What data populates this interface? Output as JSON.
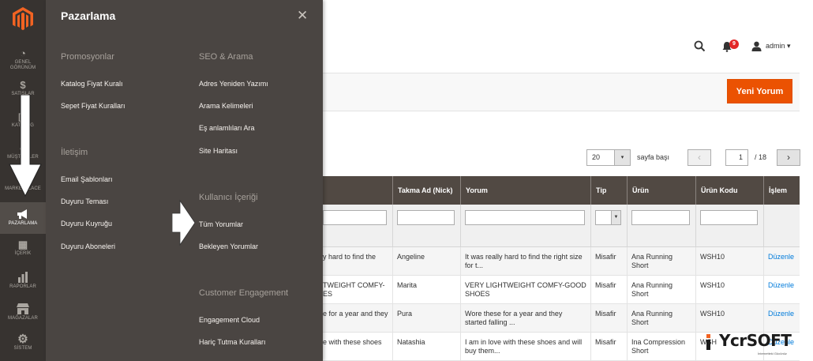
{
  "sidebar": {
    "items": [
      {
        "icon": "dashboard-icon",
        "glyph": "◔",
        "label_lines": [
          "GENEL",
          "GÖRÜNÜM"
        ]
      },
      {
        "icon": "dollar-icon",
        "glyph": "$",
        "label_lines": [
          "SATIŞLAR"
        ]
      },
      {
        "icon": "box-icon",
        "glyph": "▣",
        "label_lines": [
          "KATALOG"
        ]
      },
      {
        "icon": "customers-icon",
        "glyph": "☻",
        "label_lines": [
          "MÜŞTERİLER"
        ]
      },
      {
        "icon": "marketplace-icon",
        "glyph": "⬡",
        "label_lines": [
          "MARKETPLACE"
        ]
      },
      {
        "icon": "megaphone-icon",
        "glyph": "📢",
        "label_lines": [
          "PAZARLAMA"
        ]
      },
      {
        "icon": "content-icon",
        "glyph": "▦",
        "label_lines": [
          "İÇERİK"
        ]
      },
      {
        "icon": "reports-icon",
        "glyph": "▮",
        "label_lines": [
          "RAPORLAR"
        ]
      },
      {
        "icon": "stores-icon",
        "glyph": "⌂",
        "label_lines": [
          "MAĞAZALAR"
        ]
      },
      {
        "icon": "gear-icon",
        "glyph": "⚙",
        "label_lines": [
          "SİSTEM"
        ]
      }
    ]
  },
  "flyout": {
    "title": "Pazarlama",
    "close_glyph": "✕",
    "left_sections": [
      {
        "heading": "Promosyonlar",
        "links": [
          "Katalog Fiyat Kuralı",
          "Sepet Fiyat Kuralları"
        ]
      },
      {
        "heading": "İletişim",
        "links": [
          "Email Şablonları",
          "Duyuru Teması",
          "Duyuru Kuyruğu",
          "Duyuru Aboneleri"
        ]
      }
    ],
    "right_sections": [
      {
        "heading": "SEO & Arama",
        "links": [
          "Adres Yeniden Yazımı",
          "Arama Kelimeleri",
          "Eş anlamlıları Ara",
          "Site Haritası"
        ]
      },
      {
        "heading": "Kullanıcı İçeriği",
        "links": [
          "Tüm Yorumlar",
          "Bekleyen Yorumlar"
        ]
      },
      {
        "heading": "Customer Engagement",
        "links": [
          "Engagement Cloud",
          "Hariç Tutma Kuralları"
        ]
      }
    ]
  },
  "header": {
    "notification_count": "9",
    "user": "admin",
    "user_caret": "▾"
  },
  "actions": {
    "new_review": "Yeni Yorum"
  },
  "pager": {
    "page_size": "20",
    "page_size_caret": "▾",
    "per_page_label": "sayfa başı",
    "prev": "‹",
    "next": "›",
    "current_page": "1",
    "total_pages": "/ 18"
  },
  "grid": {
    "columns": [
      "Takma Ad (Nick)",
      "Yorum",
      "Tip",
      "Ürün",
      "Ürün Kodu",
      "İşlem"
    ],
    "rows": [
      {
        "review_cut": [
          "y hard to find the",
          ""
        ],
        "nick": "Angeline",
        "review": [
          "It was really hard to find the right size",
          "for t..."
        ],
        "type": "Misafir",
        "product": [
          "Ana Running",
          "Short"
        ],
        "sku": "WSH10",
        "action": "Düzenle"
      },
      {
        "review_cut": [
          "TWEIGHT COMFY-",
          "ES"
        ],
        "nick": "Marita",
        "review": [
          "VERY LIGHTWEIGHT COMFY-GOOD",
          "SHOES"
        ],
        "type": "Misafir",
        "product": [
          "Ana Running",
          "Short"
        ],
        "sku": "WSH10",
        "action": "Düzenle"
      },
      {
        "review_cut": [
          "e for a year and they",
          ""
        ],
        "nick": "Pura",
        "review": [
          "Wore these for a year and they",
          "started falling ..."
        ],
        "type": "Misafir",
        "product": [
          "Ana Running",
          "Short"
        ],
        "sku": "WSH10",
        "action": "Düzenle"
      },
      {
        "review_cut": [
          "e with these shoes",
          ""
        ],
        "nick": "Natashia",
        "review": [
          "I am in love with these shoes and will",
          "buy them..."
        ],
        "type": "Misafir",
        "product": [
          "Ina Compression",
          "Short"
        ],
        "sku": "WSH",
        "action": "Düzenle"
      }
    ]
  },
  "watermark": {
    "brand": "YcrSOFT",
    "tagline": "İnternetteki Gücünüz"
  },
  "colors": {
    "sidebar": "#373330",
    "flyout": "#4a4542",
    "grid_header": "#514943",
    "primary_button": "#eb5202",
    "link": "#007bdb",
    "badge": "#e22626"
  }
}
